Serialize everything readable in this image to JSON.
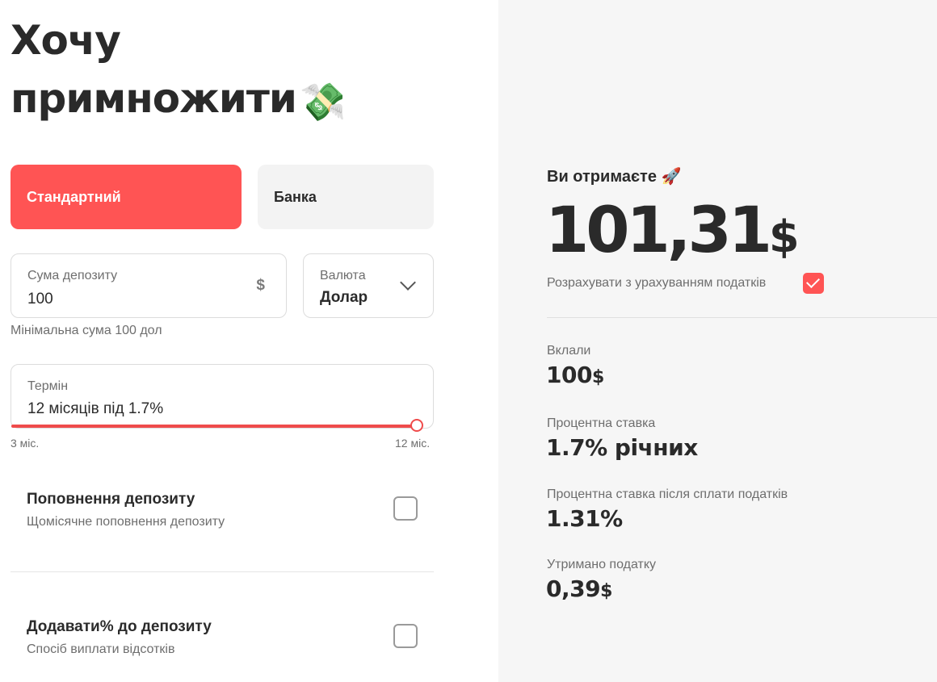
{
  "page": {
    "title_line1": "Хочу",
    "title_line2": "примножити",
    "title_emoji": "💸"
  },
  "deposit_type": {
    "standard_label": "Стандартний",
    "jar_label": "Банка",
    "selected": "Стандартний"
  },
  "sum_field": {
    "label": "Сума депозиту",
    "value": "100",
    "currency_symbol": "$",
    "hint": "Мінімальна сума 100 дол"
  },
  "currency_field": {
    "label": "Валюта",
    "value": "Долар"
  },
  "term_field": {
    "label": "Термін",
    "value": "12 місяців під 1.7%",
    "range_min": "3 міс.",
    "range_max": "12 міс.",
    "slider_fraction": 1.0
  },
  "options": [
    {
      "title": "Поповнення депозиту",
      "subtitle": "Щомісячне поповнення депозиту",
      "checked": false
    },
    {
      "title": "Додавати% до депозиту",
      "subtitle": "Спосіб виплати відсотків",
      "checked": false
    }
  ],
  "result": {
    "label": "Ви отримаєте",
    "label_emoji": "🚀",
    "amount": "101,31",
    "amount_currency": "$",
    "tax_label": "Розрахувати з урахуванням податків",
    "tax_checked": true
  },
  "stats": {
    "invested_label": "Вклали",
    "invested_value": "100",
    "invested_currency": "$",
    "rate_label": "Процентна ставка",
    "rate_value": "1.7% річних",
    "rate_after_tax_label": "Процентна ставка після сплати податків",
    "rate_after_tax_value": "1.31%",
    "tax_withheld_label": "Утримано податку",
    "tax_withheld_value": "0,39",
    "tax_withheld_currency": "$"
  },
  "colors": {
    "accent": "#ff5454",
    "panel_bg": "#f6f6f6",
    "text": "#2b2b2b",
    "muted": "#6e6e6e"
  }
}
